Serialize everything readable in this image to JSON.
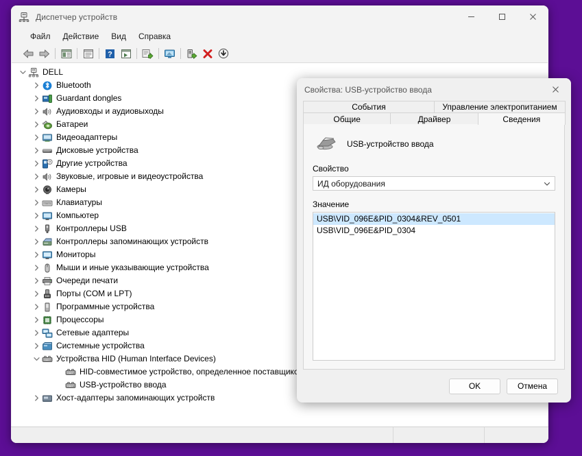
{
  "desktop": {
    "background_color": "#5c0e95"
  },
  "main_window": {
    "title": "Диспетчер устройств",
    "title_icon": "device-manager-icon",
    "controls": {
      "minimize": "minimize-icon",
      "maximize": "maximize-icon",
      "close": "close-icon"
    },
    "menu": [
      {
        "label": "Файл"
      },
      {
        "label": "Действие"
      },
      {
        "label": "Вид"
      },
      {
        "label": "Справка"
      }
    ],
    "toolbar": [
      {
        "name": "back-icon",
        "type": "button"
      },
      {
        "name": "forward-icon",
        "type": "button"
      },
      {
        "name": "separator",
        "type": "separator"
      },
      {
        "name": "properties-icon",
        "type": "button"
      },
      {
        "name": "separator",
        "type": "separator"
      },
      {
        "name": "show-hidden-icon",
        "type": "button"
      },
      {
        "name": "separator",
        "type": "separator"
      },
      {
        "name": "help-icon",
        "type": "button"
      },
      {
        "name": "update-driver-icon",
        "type": "button"
      },
      {
        "name": "separator",
        "type": "separator"
      },
      {
        "name": "scan-hardware-changes-icon",
        "type": "button"
      },
      {
        "name": "separator",
        "type": "separator"
      },
      {
        "name": "monitor-icon",
        "type": "button"
      },
      {
        "name": "separator",
        "type": "separator"
      },
      {
        "name": "enable-device-icon",
        "type": "button"
      },
      {
        "name": "uninstall-device-icon",
        "type": "button"
      },
      {
        "name": "disable-device-icon",
        "type": "button"
      }
    ],
    "tree": {
      "root": {
        "label": "DELL",
        "icon": "computer-icon",
        "expanded": true,
        "indent": 0
      },
      "items": [
        {
          "label": "Bluetooth",
          "icon": "bluetooth-icon",
          "expandable": true,
          "indent": 1
        },
        {
          "label": "Guardant dongles",
          "icon": "dongle-icon",
          "expandable": true,
          "indent": 1
        },
        {
          "label": "Аудиовходы и аудиовыходы",
          "icon": "audio-icon",
          "expandable": true,
          "indent": 1
        },
        {
          "label": "Батареи",
          "icon": "battery-icon",
          "expandable": true,
          "indent": 1
        },
        {
          "label": "Видеоадаптеры",
          "icon": "display-adapter-icon",
          "expandable": true,
          "indent": 1
        },
        {
          "label": "Дисковые устройства",
          "icon": "disk-drive-icon",
          "expandable": true,
          "indent": 1
        },
        {
          "label": "Другие устройства",
          "icon": "other-devices-icon",
          "expandable": true,
          "indent": 1
        },
        {
          "label": "Звуковые, игровые и видеоустройства",
          "icon": "sound-video-icon",
          "expandable": true,
          "indent": 1
        },
        {
          "label": "Камеры",
          "icon": "camera-icon",
          "expandable": true,
          "indent": 1
        },
        {
          "label": "Клавиатуры",
          "icon": "keyboard-icon",
          "expandable": true,
          "indent": 1
        },
        {
          "label": "Компьютер",
          "icon": "computer-monitor-icon",
          "expandable": true,
          "indent": 1
        },
        {
          "label": "Контроллеры USB",
          "icon": "usb-controller-icon",
          "expandable": true,
          "indent": 1
        },
        {
          "label": "Контроллеры запоминающих устройств",
          "icon": "storage-controller-icon",
          "expandable": true,
          "indent": 1
        },
        {
          "label": "Мониторы",
          "icon": "monitor-icon",
          "expandable": true,
          "indent": 1
        },
        {
          "label": "Мыши и иные указывающие устройства",
          "icon": "mouse-icon",
          "expandable": true,
          "indent": 1
        },
        {
          "label": "Очереди печати",
          "icon": "printer-icon",
          "expandable": true,
          "indent": 1
        },
        {
          "label": "Порты (COM и LPT)",
          "icon": "port-icon",
          "expandable": true,
          "indent": 1
        },
        {
          "label": "Программные устройства",
          "icon": "software-device-icon",
          "expandable": true,
          "indent": 1
        },
        {
          "label": "Процессоры",
          "icon": "processor-icon",
          "expandable": true,
          "indent": 1
        },
        {
          "label": "Сетевые адаптеры",
          "icon": "network-adapter-icon",
          "expandable": true,
          "indent": 1
        },
        {
          "label": "Системные устройства",
          "icon": "system-device-icon",
          "expandable": true,
          "indent": 1
        },
        {
          "label": "Устройства HID (Human Interface Devices)",
          "icon": "hid-icon",
          "expandable": true,
          "expanded": true,
          "indent": 1
        },
        {
          "label": "HID-совместимое устройство, определенное поставщиком",
          "icon": "hid-icon",
          "expandable": false,
          "indent": 2
        },
        {
          "label": "USB-устройство ввода",
          "icon": "hid-icon",
          "expandable": false,
          "indent": 2
        },
        {
          "label": "Хост-адаптеры запоминающих устройств",
          "icon": "host-adapter-icon",
          "expandable": true,
          "indent": 1
        }
      ]
    },
    "statusbar": {
      "pane1": "",
      "pane2": "",
      "pane3": ""
    }
  },
  "dialog": {
    "title": "Свойства: USB-устройство ввода",
    "close_icon": "close-icon",
    "tabs_row1": [
      {
        "label": "События",
        "selected": false
      },
      {
        "label": "Управление электропитанием",
        "selected": false
      }
    ],
    "tabs_row2": [
      {
        "label": "Общие",
        "selected": false
      },
      {
        "label": "Драйвер",
        "selected": false
      },
      {
        "label": "Сведения",
        "selected": true
      }
    ],
    "device": {
      "icon": "hid-device-icon",
      "name": "USB-устройство ввода"
    },
    "property": {
      "label": "Свойство",
      "selected_value": "ИД оборудования",
      "dropdown_icon": "chevron-down-icon"
    },
    "value": {
      "label": "Значение",
      "items": [
        {
          "text": "USB\\VID_096E&PID_0304&REV_0501",
          "selected": true
        },
        {
          "text": "USB\\VID_096E&PID_0304",
          "selected": false
        }
      ]
    },
    "buttons": {
      "ok": "OK",
      "cancel": "Отмена"
    },
    "accent_selection_color": "#cde8ff"
  }
}
